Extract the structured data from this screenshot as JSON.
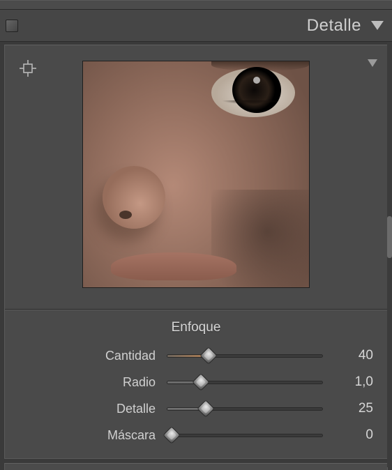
{
  "header": {
    "title": "Detalle"
  },
  "sharpen": {
    "title": "Enfoque",
    "sliders": [
      {
        "label": "Cantidad",
        "value": "40",
        "percent": 27,
        "accent": true
      },
      {
        "label": "Radio",
        "value": "1,0",
        "percent": 22,
        "accent": false
      },
      {
        "label": "Detalle",
        "value": "25",
        "percent": 25,
        "accent": false
      },
      {
        "label": "Máscara",
        "value": "0",
        "percent": 3,
        "accent": false
      }
    ]
  }
}
